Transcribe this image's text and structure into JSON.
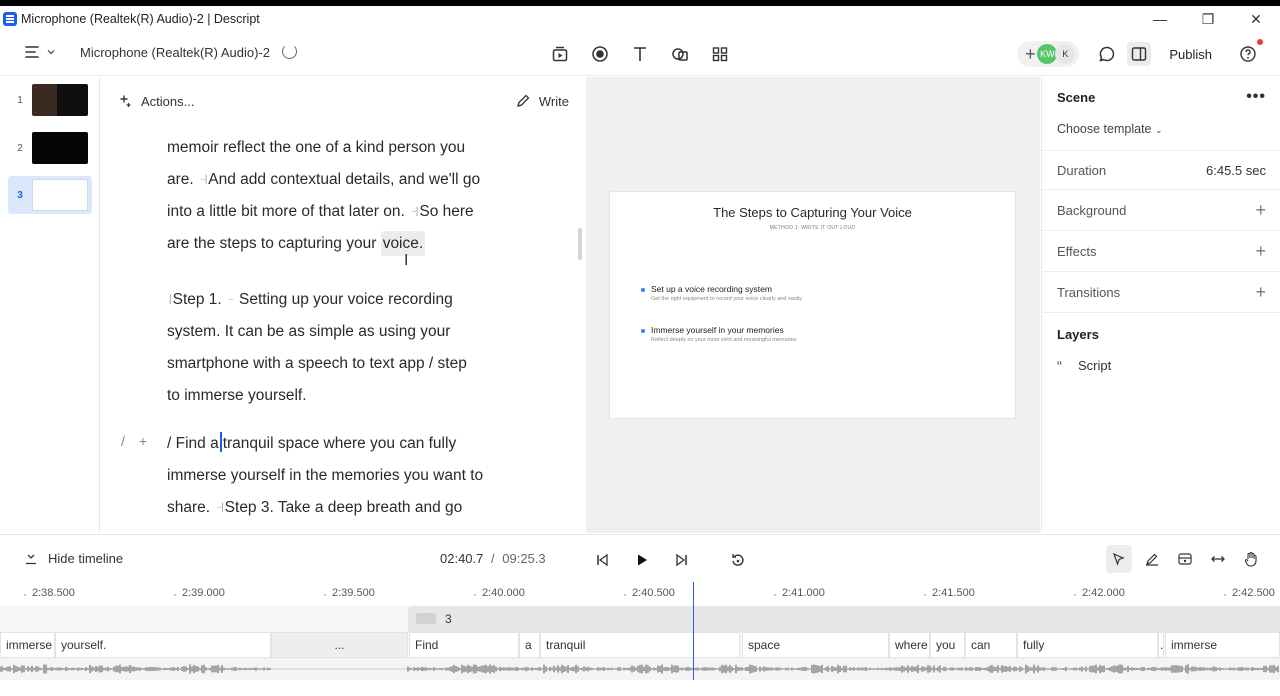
{
  "window": {
    "title": "Microphone (Realtek(R) Audio)-2 | Descript"
  },
  "toolbar": {
    "project_name": "Microphone (Realtek(R) Audio)-2",
    "publish_label": "Publish",
    "collaborators": [
      "KW",
      "K"
    ]
  },
  "scenes": [
    {
      "number": "1",
      "selected": false
    },
    {
      "number": "2",
      "selected": false
    },
    {
      "number": "3",
      "selected": true
    }
  ],
  "script": {
    "actions_label": "Actions...",
    "write_label": "Write",
    "para1": {
      "l1": "memoir reflect the one of a kind person you",
      "l2a": "are.",
      "l2b": "And add contextual details, and we'll go",
      "l3a": "into a little bit more of that later on.",
      "l3b": "So here",
      "l4a": "are the steps to capturing your",
      "l4b": "voice."
    },
    "para2": {
      "l1": "Step 1.",
      "l1b": "Setting up your voice recording",
      "l2": "system. It can be as simple as using your",
      "l3": "smartphone with a speech to text app  / step",
      "l4": "to immerse yourself."
    },
    "para3": {
      "l1a": "/ Find a",
      "l1b": "tranquil space where you can fully",
      "l2": "immerse yourself in the memories you want to",
      "l3a": "share.",
      "l3b": "Step 3. Take a deep breath and go"
    },
    "gutter_slash": "/",
    "gutter_plus": "+"
  },
  "slide": {
    "title": "The Steps to Capturing Your Voice",
    "subtitle": "METHOD 1: WRITE IT OUT LOUD",
    "bullets": [
      {
        "heading": "Set up a voice recording system",
        "detail": "Get the right equipment to record your voice clearly and easily"
      },
      {
        "heading": "Immerse yourself in your memories",
        "detail": "Reflect deeply on your most vivid and meaningful memories"
      }
    ]
  },
  "properties": {
    "scene_label": "Scene",
    "choose_template": "Choose template",
    "duration_label": "Duration",
    "duration_value": "6:45.5 sec",
    "background_label": "Background",
    "effects_label": "Effects",
    "transitions_label": "Transitions",
    "layers_label": "Layers",
    "layer_items": [
      {
        "name": "Script",
        "icon": "quote-icon"
      }
    ]
  },
  "timeline": {
    "hide_label": "Hide timeline",
    "current_time": "02:40.7",
    "separator": "/",
    "total_time": "09:25.3",
    "ruler": [
      "2:38.500",
      "2:39.000",
      "2:39.500",
      "2:40.000",
      "2:40.500",
      "2:41.000",
      "2:41.500",
      "2:42.000",
      "2:42.500"
    ],
    "scene_clip_label": "3",
    "words": [
      "immerse",
      "yourself.",
      "...",
      "Find",
      "a",
      "tranquil",
      "space",
      "where",
      "you",
      "can",
      "fully",
      ".",
      "immerse"
    ]
  },
  "colors": {
    "accent": "#1d5bf5",
    "playhead": "#2b5fd9",
    "selected_scene": "#dbe7fb"
  }
}
